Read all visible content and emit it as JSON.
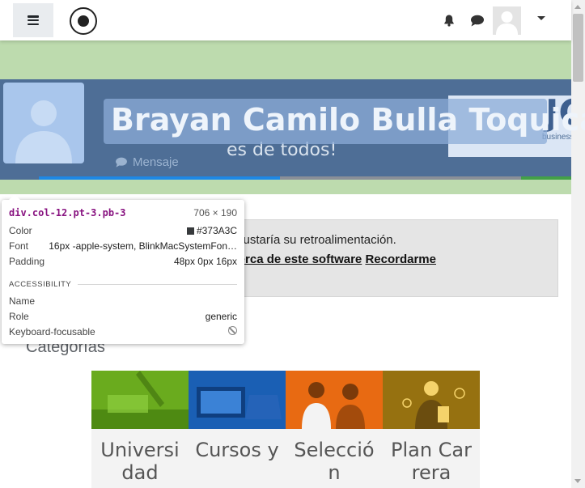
{
  "header": {
    "menu_icon": "hamburger-icon",
    "logo_icon": "site-logo",
    "notification_icon": "bell-icon",
    "messages_icon": "chat-icon",
    "user_menu_icon": "caret-down-icon"
  },
  "profile": {
    "name": "Brayan Camilo Bulla Toquica",
    "message_label": "Mensaje",
    "banner_text": "es de todos!"
  },
  "notice": {
    "line1": "are les gustaría su retroalimentación.",
    "link1": "ción acerca de este software",
    "link2": "Recordarme"
  },
  "categories": {
    "title": "Categorías",
    "items": [
      {
        "label": "Universidad",
        "color": "#6aab1e"
      },
      {
        "label": "Cursos y",
        "color": "#1a5fb4"
      },
      {
        "label": "Selección",
        "color": "#e86a12"
      },
      {
        "label": "Plan Carrera",
        "color": "#d4a017"
      }
    ]
  },
  "inspector": {
    "selector": "div.col-12.pt-3.pb-3",
    "dimensions": "706 × 190",
    "color_label": "Color",
    "color_value": "#373A3C",
    "font_label": "Font",
    "font_value": "16px -apple-system, BlinkMacSystemFon…",
    "padding_label": "Padding",
    "padding_value": "48px 0px 16px",
    "section_title": "ACCESSIBILITY",
    "name_label": "Name",
    "name_value": "",
    "role_label": "Role",
    "role_value": "generic",
    "focus_label": "Keyboard-focusable"
  },
  "colors": {
    "banner_blue": "#4e6e96",
    "green_band": "#bddbae",
    "selector_purple": "#881280"
  }
}
